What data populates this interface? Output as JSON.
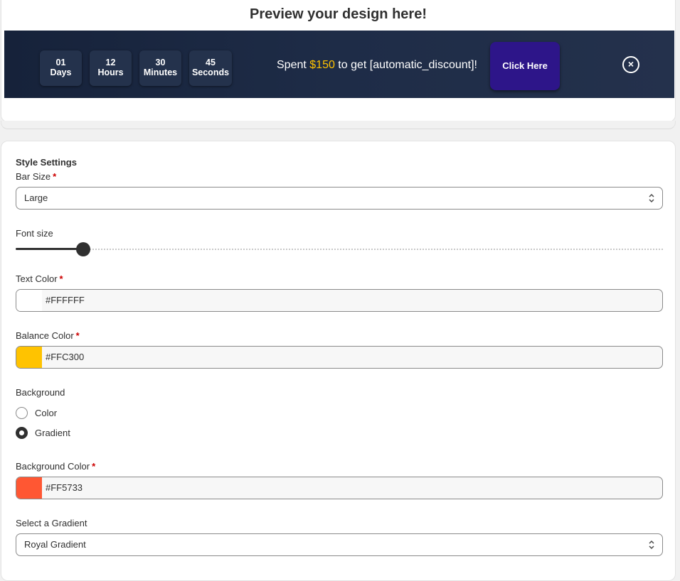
{
  "preview": {
    "title": "Preview your design here!",
    "timer": [
      {
        "value": "01",
        "unit": "Days"
      },
      {
        "value": "12",
        "unit": "Hours"
      },
      {
        "value": "30",
        "unit": "Minutes"
      },
      {
        "value": "45",
        "unit": "Seconds"
      }
    ],
    "message_prefix": "Spent ",
    "message_amount": "$150",
    "message_suffix": " to get [automatic_discount]!",
    "cta_label": "Click Here",
    "close_icon": "×",
    "colors": {
      "text": "#FFFFFF",
      "balance": "#FFC300",
      "button": "#2D1589"
    }
  },
  "settings": {
    "section_title": "Style Settings",
    "bar_size": {
      "label": "Bar Size",
      "required": "*",
      "value": "Large"
    },
    "font_size": {
      "label": "Font size",
      "value_fraction": 0.105
    },
    "text_color": {
      "label": "Text Color",
      "required": "*",
      "value": "#FFFFFF",
      "swatch": "#FFFFFF"
    },
    "balance_color": {
      "label": "Balance Color",
      "required": "*",
      "value": "#FFC300",
      "swatch": "#FFC300"
    },
    "background": {
      "label": "Background",
      "options": [
        {
          "label": "Color",
          "selected": false
        },
        {
          "label": "Gradient",
          "selected": true
        }
      ]
    },
    "background_color": {
      "label": "Background Color",
      "required": "*",
      "value": "#FF5733",
      "swatch": "#FF5733"
    },
    "gradient": {
      "label": "Select a Gradient",
      "value": "Royal Gradient"
    }
  }
}
